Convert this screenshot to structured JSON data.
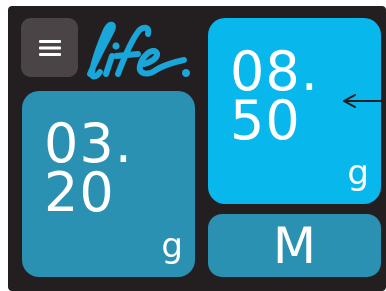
{
  "app": {
    "logo_text": "life.",
    "icons": {
      "menu": "hamburger-menu-icon",
      "arrow": "arrow-left-icon"
    }
  },
  "tiles": {
    "left": {
      "value_line1": "03.",
      "value_line2": "20",
      "unit": "g",
      "color": "#2a91b3"
    },
    "right": {
      "value_line1": "08.",
      "value_line2": "50",
      "unit": "g",
      "color": "#08b8ec"
    },
    "mode": {
      "label": "M",
      "color": "#2a91b3"
    }
  },
  "colors": {
    "background": "#231f20",
    "menu_button": "#4a4446",
    "logo": "#1aa6d8"
  }
}
